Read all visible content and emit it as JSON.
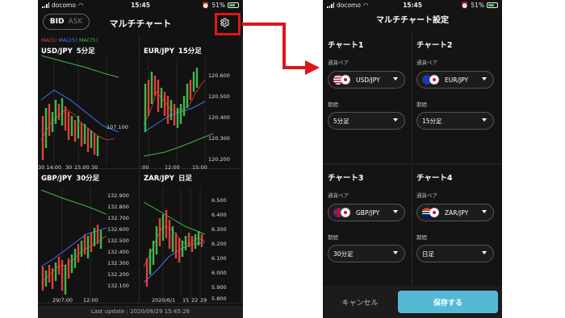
{
  "left_screen": {
    "status": {
      "carrier": "docomo",
      "time": "15:45",
      "battery": "51%"
    },
    "header": {
      "bid_label": "BID",
      "ask_label": "ASK",
      "title": "マルチチャート",
      "settings_icon": "gear-icon"
    },
    "ma_legend": {
      "ma5": "MA(5)",
      "ma25": "MA(25)",
      "ma75": "MA(75)"
    },
    "panels": [
      {
        "pair": "USD/JPY",
        "period": "5分足",
        "prices": [
          "107.100"
        ],
        "times": [
          "30 14:00",
          "30",
          "15:00",
          "30"
        ]
      },
      {
        "pair": "EUR/JPY",
        "period": "15分足",
        "prices": [
          "120.600",
          "120.500",
          "120.400",
          "120.300",
          "120.200"
        ],
        "times": [
          ":00",
          "12:00",
          "15:00"
        ]
      },
      {
        "pair": "GBP/JPY",
        "period": "30分足",
        "prices": [
          "132.900",
          "132.800",
          "132.700",
          "132.600",
          "132.500",
          "132.400",
          "132.300",
          "132.200",
          "132.100"
        ],
        "times": [
          "29/7:00",
          "12:00"
        ]
      },
      {
        "pair": "ZAR/JPY",
        "period": "日足",
        "prices": [
          "6.500",
          "6.400",
          "6.300",
          "6.200",
          "6.100",
          "6.000",
          "5.900",
          "5.800"
        ],
        "times": [
          "2020/6/1",
          "15",
          "22",
          "29"
        ]
      }
    ],
    "last_update": "Last update : 2020/06/29 15:45:26"
  },
  "right_screen": {
    "status": {
      "carrier": "docomo",
      "time": "15:45",
      "battery": "51%"
    },
    "title": "マルチチャート設定",
    "pair_label": "通貨ペア",
    "period_label": "期間",
    "charts": [
      {
        "title": "チャート1",
        "pair": "USD/JPY",
        "period": "5分足"
      },
      {
        "title": "チャート2",
        "pair": "EUR/JPY",
        "period": "15分足"
      },
      {
        "title": "チャート3",
        "pair": "GBP/JPY",
        "period": "30分足"
      },
      {
        "title": "チャート4",
        "pair": "ZAR/JPY",
        "period": "日足"
      }
    ],
    "cancel_label": "キャンセル",
    "save_label": "保存する"
  },
  "colors": {
    "highlight": "#e0151b",
    "ma5": "#e0403a",
    "ma25": "#3c76ff",
    "ma75": "#3fb84b",
    "save": "#55b9d6"
  }
}
